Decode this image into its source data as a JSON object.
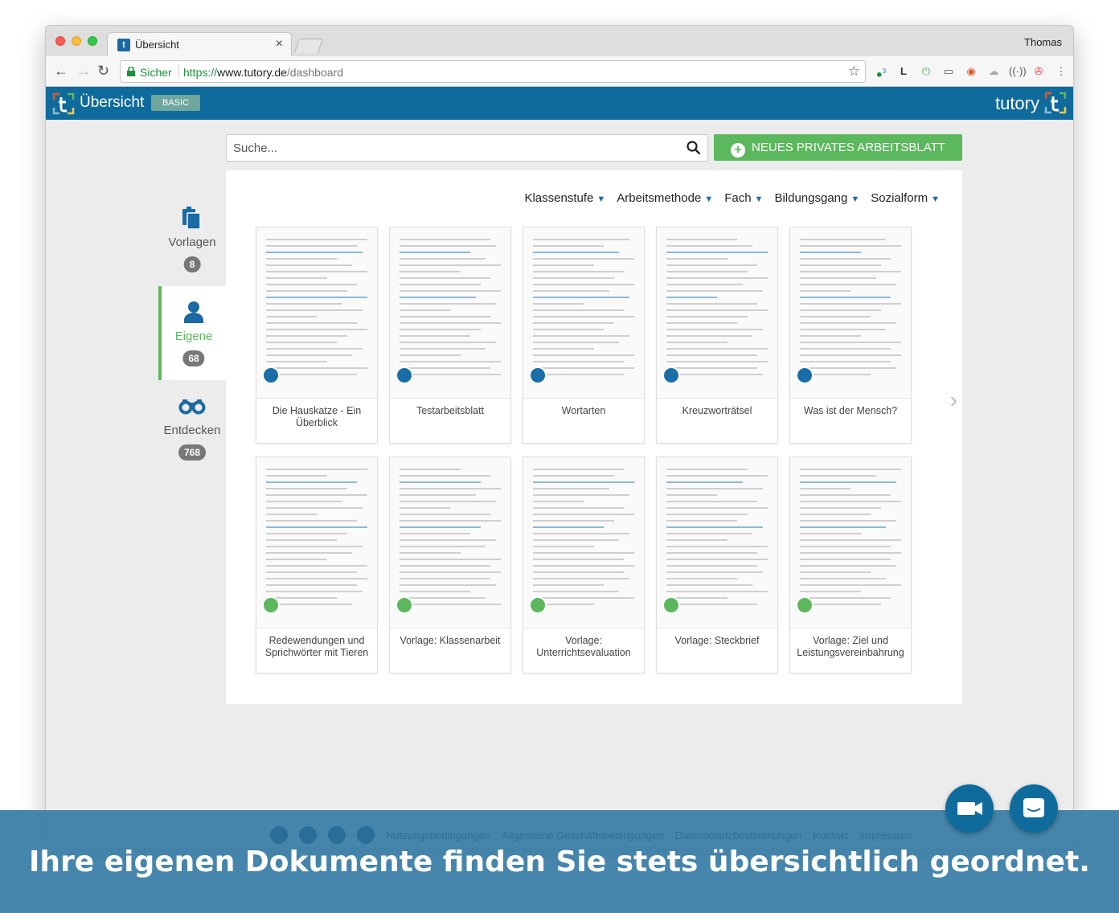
{
  "browser": {
    "tab_title": "Übersicht",
    "user_name": "Thomas",
    "secure_label": "Sicher",
    "url_scheme": "https://",
    "url_host": "www.tutory.de",
    "url_path": "/dashboard",
    "extension_badge": "3",
    "extension_letter": "L"
  },
  "app": {
    "title": "Übersicht",
    "plan": "BASIC",
    "brand": "tutory",
    "brand_color": "#0f6b9c",
    "accent_color": "#5cb85c"
  },
  "search": {
    "placeholder": "Suche..."
  },
  "new_button": {
    "label": "NEUES PRIVATES ARBEITSBLATT"
  },
  "filters": [
    "Klassenstufe",
    "Arbeitsmethode",
    "Fach",
    "Bildungsgang",
    "Sozialform"
  ],
  "sidebar": [
    {
      "label": "Vorlagen",
      "count": "8",
      "icon": "clipboard-icon",
      "active": false
    },
    {
      "label": "Eigene",
      "count": "68",
      "icon": "user-icon",
      "active": true
    },
    {
      "label": "Entdecken",
      "count": "768",
      "icon": "binoculars-icon",
      "active": false
    }
  ],
  "cards": [
    {
      "title": "Die Hauskatze - Ein Überblick",
      "status": "locked"
    },
    {
      "title": "Testarbeitsblatt",
      "status": "locked"
    },
    {
      "title": "Wortarten",
      "status": "locked"
    },
    {
      "title": "Kreuzworträtsel",
      "status": "locked"
    },
    {
      "title": "Was ist der Mensch?",
      "status": "locked"
    },
    {
      "title": "Redewendungen und Sprichwörter mit Tieren",
      "status": "shared"
    },
    {
      "title": "Vorlage: Klassenarbeit",
      "status": "shared"
    },
    {
      "title": "Vorlage: Unterrichtsevaluation",
      "status": "shared"
    },
    {
      "title": "Vorlage: Steckbrief",
      "status": "shared"
    },
    {
      "title": "Vorlage: Ziel und Leistungsvereinbahrung",
      "status": "shared"
    }
  ],
  "footer_links": [
    "Nutzungsbedingungen",
    "Allgemeine Geschäftsbedingungen",
    "Datenschutzbestimmungen",
    "Kontakt",
    "Impressum"
  ],
  "caption": "Ihre eigenen Dokumente finden Sie stets übersichtlich geordnet."
}
